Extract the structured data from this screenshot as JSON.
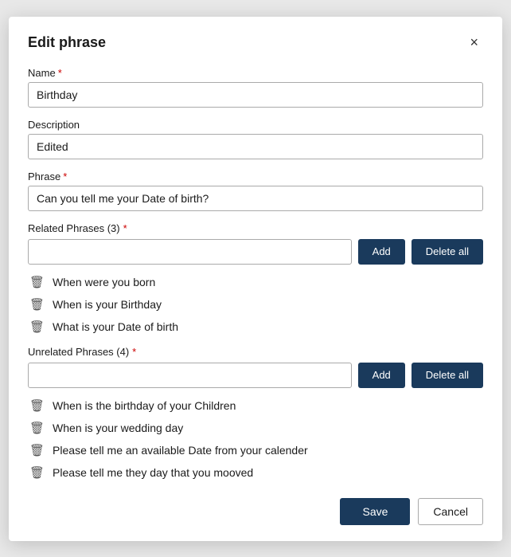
{
  "dialog": {
    "title": "Edit phrase",
    "close_label": "×"
  },
  "fields": {
    "name_label": "Name",
    "name_value": "Birthday",
    "description_label": "Description",
    "description_value": "Edited",
    "phrase_label": "Phrase",
    "phrase_value": "Can you tell me your Date of birth?"
  },
  "related": {
    "label": "Related Phrases (3)",
    "add_placeholder": "",
    "add_btn": "Add",
    "delete_all_btn": "Delete all",
    "items": [
      "When were you born",
      "When is your Birthday",
      "What is your Date of birth"
    ]
  },
  "unrelated": {
    "label": "Unrelated Phrases (4)",
    "add_placeholder": "",
    "add_btn": "Add",
    "delete_all_btn": "Delete all",
    "items": [
      "When is the birthday of your Children",
      "When is your wedding day",
      "Please tell me an available Date from your calender",
      "Please tell me they day that you mooved"
    ]
  },
  "footer": {
    "save_label": "Save",
    "cancel_label": "Cancel"
  }
}
